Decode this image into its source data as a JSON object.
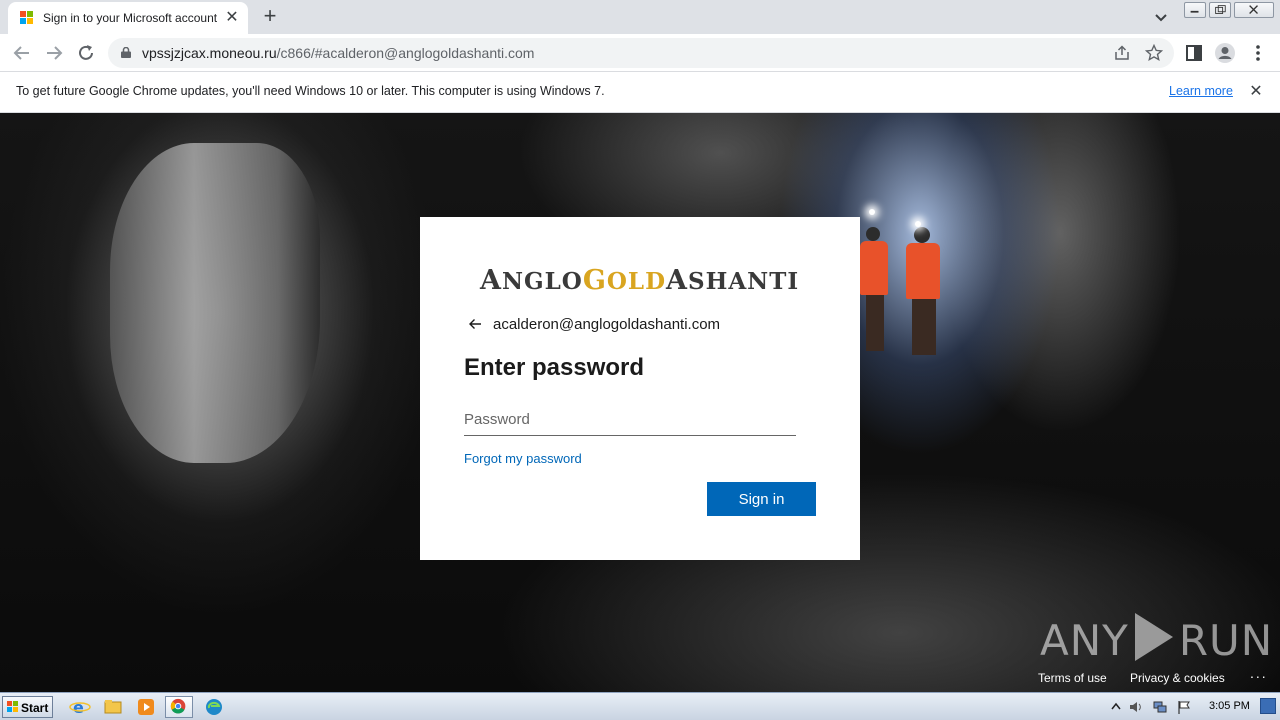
{
  "browser": {
    "tab_title": "Sign in to your Microsoft account",
    "new_tab_label": "+",
    "close_glyph": "✕",
    "url_host": "vpssjzjcax.moneou.ru",
    "url_path": "/c866/#acalderon@anglogoldashanti.com",
    "icons": [
      "back-icon",
      "forward-icon",
      "reload-icon",
      "lock-icon",
      "share-icon",
      "bookmark-star-icon",
      "side-panel-icon",
      "profile-icon",
      "menu-icon",
      "tab-search-icon"
    ]
  },
  "infobar": {
    "message": "To get future Google Chrome updates, you'll need Windows 10 or later. This computer is using Windows 7.",
    "link": "Learn more",
    "close_glyph": "✕"
  },
  "login": {
    "logo_parts": [
      "A",
      "NGLO",
      "G",
      "OLD",
      "A",
      "SHANTI"
    ],
    "identity": "acalderon@anglogoldashanti.com",
    "title": "Enter password",
    "password_placeholder": "Password",
    "password_value": "",
    "forgot_link": "Forgot my password",
    "signin_button": "Sign in"
  },
  "footer": {
    "terms": "Terms of use",
    "privacy": "Privacy & cookies",
    "more": "..."
  },
  "watermark": {
    "left": "ANY",
    "right": "RUN"
  },
  "taskbar": {
    "start_label": "Start",
    "clock": "3:05 PM",
    "apps": [
      "internet-explorer-icon",
      "file-explorer-icon",
      "media-player-icon",
      "chrome-icon",
      "edge-icon"
    ]
  },
  "colors": {
    "accent_blue": "#0067b8",
    "link_blue": "#1a73e8",
    "logo_gold": "#d9a520",
    "logo_gray": "#3a3a3a"
  }
}
